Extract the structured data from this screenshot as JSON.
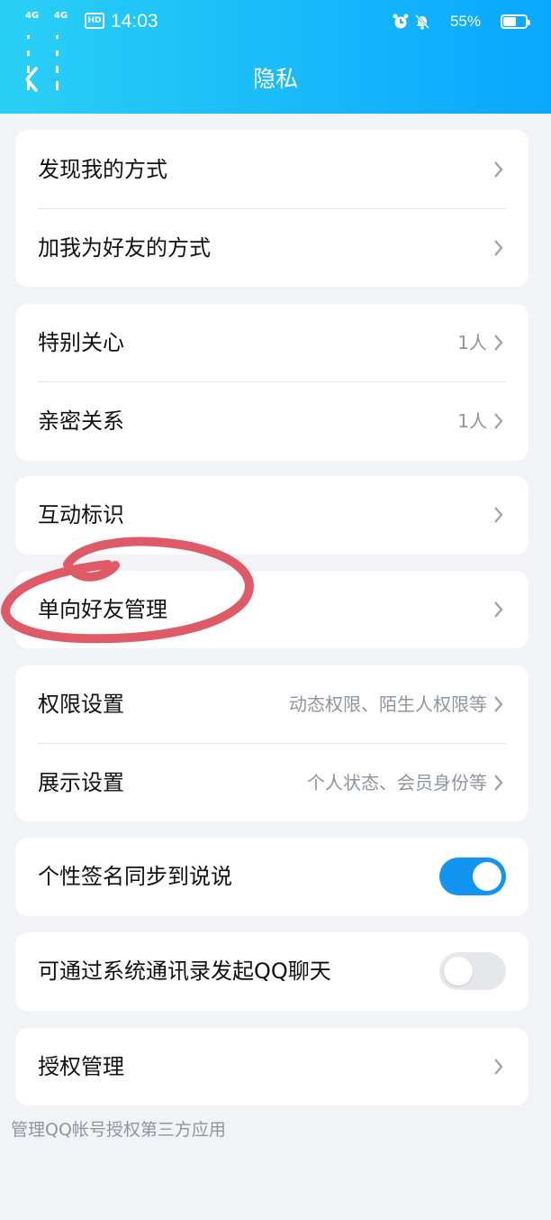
{
  "status_bar": {
    "network_1": "4G",
    "network_2": "4G",
    "hd_badge": "HD",
    "time": "14:03",
    "battery_percent": "55%",
    "icons": [
      "alarm-icon",
      "muted-bell-icon",
      "battery-icon"
    ]
  },
  "header": {
    "title": "隐私",
    "background_colors": [
      "#29d0f5",
      "#0aa7ff"
    ]
  },
  "sections": {
    "discover": {
      "items": [
        {
          "label": "发现我的方式",
          "value": ""
        },
        {
          "label": "加我为好友的方式",
          "value": ""
        }
      ]
    },
    "relations": {
      "items": [
        {
          "label": "特别关心",
          "value": "1人"
        },
        {
          "label": "亲密关系",
          "value": "1人"
        }
      ]
    },
    "interaction": {
      "items": [
        {
          "label": "互动标识",
          "value": ""
        }
      ]
    },
    "oneway": {
      "items": [
        {
          "label": "单向好友管理",
          "value": ""
        }
      ]
    },
    "settings": {
      "items": [
        {
          "label": "权限设置",
          "value": "动态权限、陌生人权限等"
        },
        {
          "label": "展示设置",
          "value": "个人状态、会员身份等"
        }
      ]
    },
    "signature_sync": {
      "label": "个性签名同步到说说",
      "toggle_on": true
    },
    "contacts_chat": {
      "label": "可通过系统通讯录发起QQ聊天",
      "toggle_on": false
    },
    "authorization": {
      "label": "授权管理",
      "footer": "管理QQ帐号授权第三方应用"
    }
  },
  "colors": {
    "accent": "#1295f0",
    "background": "#f2f3f7",
    "annotation": "#df5a67"
  }
}
